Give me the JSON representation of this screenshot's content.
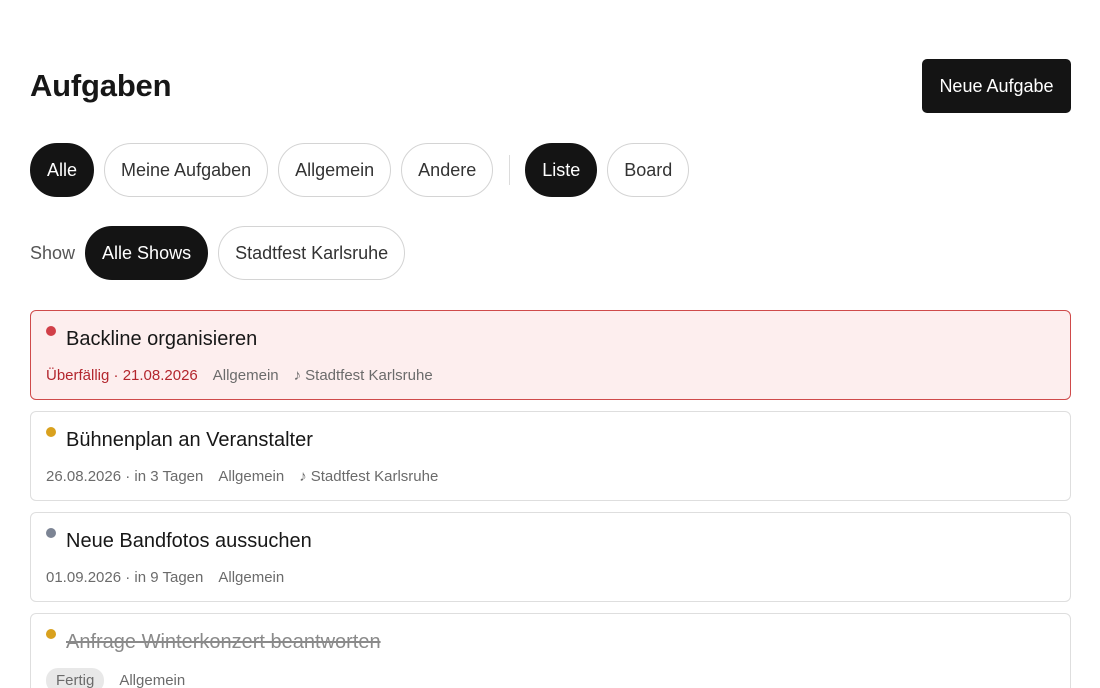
{
  "header": {
    "title": "Aufgaben",
    "new_task_label": "Neue Aufgabe"
  },
  "filters": {
    "scope": [
      {
        "label": "Alle",
        "active": true
      },
      {
        "label": "Meine Aufgaben",
        "active": false
      },
      {
        "label": "Allgemein",
        "active": false
      },
      {
        "label": "Andere",
        "active": false
      }
    ],
    "view": [
      {
        "label": "Liste",
        "active": true
      },
      {
        "label": "Board",
        "active": false
      }
    ]
  },
  "show_filter": {
    "label": "Show",
    "options": [
      {
        "label": "Alle Shows",
        "active": true
      },
      {
        "label": "Stadtfest Karlsruhe",
        "active": false
      }
    ]
  },
  "tasks": [
    {
      "title": "Backline organisieren",
      "priority_color": "#d13f48",
      "due": "Überfällig · 21.08.2026",
      "category": "Allgemein",
      "show_icon": "music-note-icon",
      "show_glyph": "♪",
      "show": "Stadtfest Karlsruhe"
    },
    {
      "title": "Bühnenplan an Veranstalter",
      "priority_color": "#d9a11e",
      "due": "26.08.2026 · in 3 Tagen",
      "category": "Allgemein",
      "show_icon": "music-note-icon",
      "show_glyph": "♪",
      "show": "Stadtfest Karlsruhe"
    },
    {
      "title": "Neue Bandfotos aussuchen",
      "priority_color": "#7c8494",
      "due": "01.09.2026 · in 9 Tagen",
      "category": "Allgemein"
    },
    {
      "title": "Anfrage Winterkonzert beantworten",
      "priority_color": "#d9a11e",
      "status": "Fertig",
      "category": "Allgemein"
    }
  ],
  "colors": {
    "accent": "#141414",
    "overdue_bg": "#fdeeee",
    "overdue_border": "#cf4a4a",
    "overdue_text": "#b3262d"
  }
}
